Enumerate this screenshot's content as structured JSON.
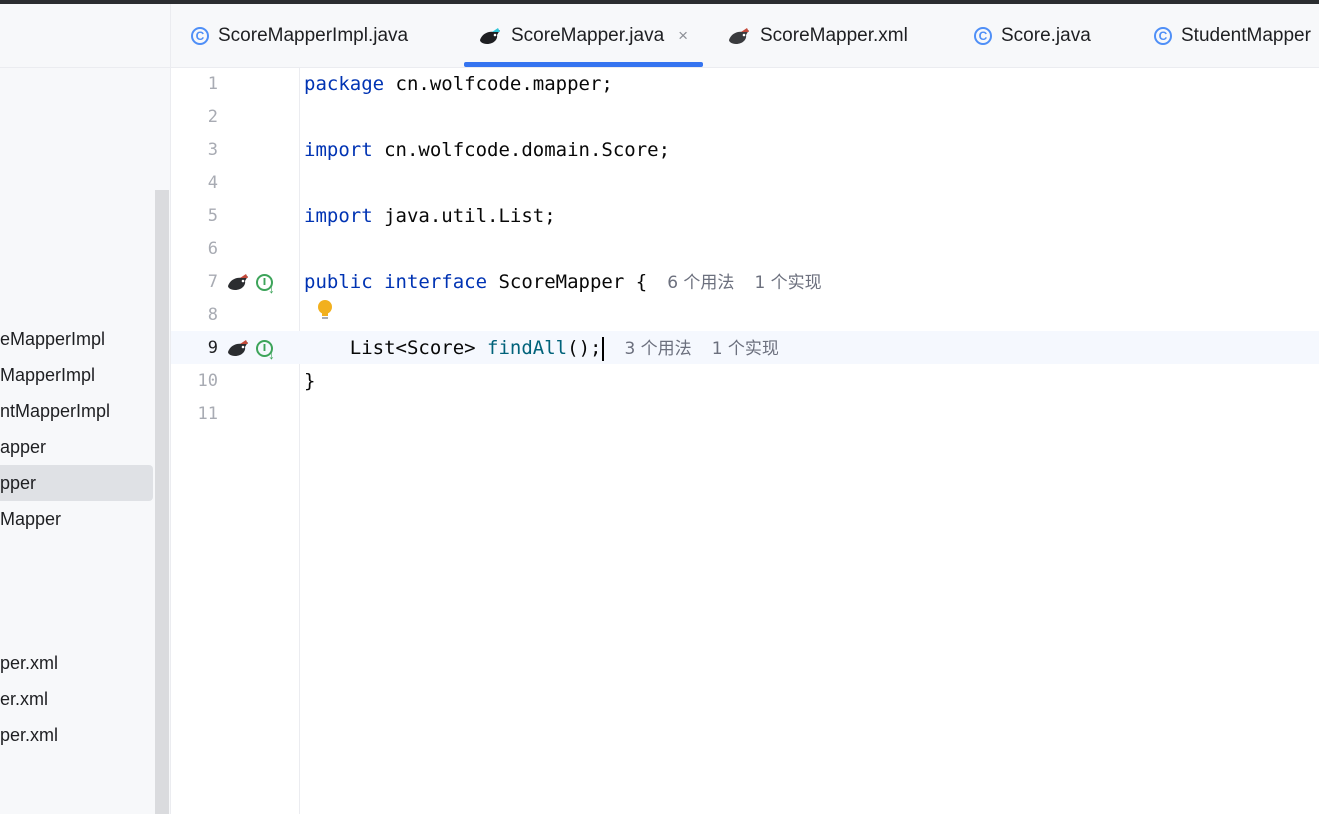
{
  "sidebar": {
    "items": [
      {
        "label": "eMapperImpl",
        "selected": false
      },
      {
        "label": "MapperImpl",
        "selected": false
      },
      {
        "label": "ntMapperImpl",
        "selected": false
      },
      {
        "label": "apper",
        "selected": false
      },
      {
        "label": "pper",
        "selected": true
      },
      {
        "label": "Mapper",
        "selected": false
      },
      {
        "label": "per.xml",
        "selected": false
      },
      {
        "label": "er.xml",
        "selected": false
      },
      {
        "label": "per.xml",
        "selected": false
      }
    ]
  },
  "tabs": [
    {
      "label": "ScoreMapperImpl.java",
      "icon": "class-icon",
      "active": false
    },
    {
      "label": "ScoreMapper.java",
      "icon": "mybatis-icon",
      "active": true,
      "close": "×"
    },
    {
      "label": "ScoreMapper.xml",
      "icon": "mybatis-icon",
      "active": false
    },
    {
      "label": "Score.java",
      "icon": "class-icon",
      "active": false
    },
    {
      "label": "StudentMapper",
      "icon": "class-icon",
      "active": false
    }
  ],
  "editor": {
    "current_line": 9,
    "line_numbers": [
      "1",
      "2",
      "3",
      "4",
      "5",
      "6",
      "7",
      "8",
      "9",
      "10",
      "11"
    ],
    "lines": {
      "l1": {
        "kw": "package",
        "rest": " cn.wolfcode.mapper;"
      },
      "l3": {
        "kw": "import",
        "rest": " cn.wolfcode.domain.Score;"
      },
      "l5": {
        "kw": "import",
        "rest": " java.util.List;"
      },
      "l7": {
        "kw1": "public",
        "kw2": "interface",
        "rest": " ScoreMapper {",
        "hint_usages": "6 个用法",
        "hint_impls": "1 个实现"
      },
      "l9": {
        "indent": "    ",
        "type": "List<Score> ",
        "method": "findAll",
        "rest": "();",
        "hint_usages": "3 个用法",
        "hint_impls": "1 个实现"
      },
      "l10": {
        "text": "}"
      }
    },
    "gutter_icon_glyph": "I",
    "gutter_arrow": "↓"
  },
  "colors": {
    "keyword": "#0033b3",
    "method": "#00627a",
    "accent": "#3574f0",
    "impl": "#3da45a"
  }
}
